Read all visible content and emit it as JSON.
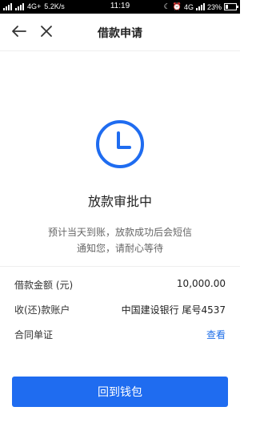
{
  "status_bar": {
    "carrier_text": "4G+",
    "speed": "5.2K/s",
    "time": "11:19",
    "network_right": "4G",
    "battery": "23%"
  },
  "navbar": {
    "title": "借款申请"
  },
  "status": {
    "title": "放款审批中",
    "desc_line1": "预计当天到账，放款成功后会短信",
    "desc_line2": "通知您，请耐心等待"
  },
  "details": {
    "amount_label": "借款金额 (元)",
    "amount_value": "10,000.00",
    "account_label": "收(还)款账户",
    "account_value": "中国建设银行 尾号4537",
    "contract_label": "合同单证",
    "contract_link": "查看"
  },
  "actions": {
    "return_wallet": "回到钱包"
  },
  "colors": {
    "accent": "#1f6cf0",
    "link": "#1e6ee8"
  }
}
